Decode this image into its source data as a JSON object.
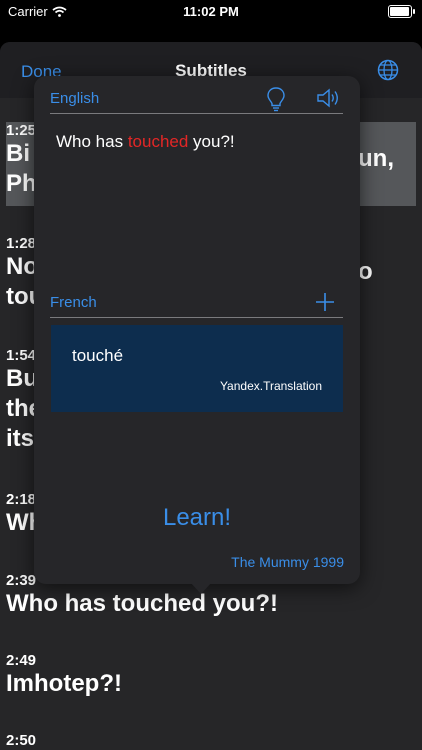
{
  "status": {
    "carrier": "Carrier",
    "time": "11:02 PM"
  },
  "nav": {
    "done": "Done",
    "title": "Subtitles"
  },
  "entries": [
    {
      "time": "1:25",
      "line1": "Bi",
      "line2": "Ph",
      "tail1": "un,",
      "tail2": ""
    },
    {
      "time": "1:28",
      "line1": "No",
      "line2": "tou",
      "tail1": "o",
      "tail2": ""
    },
    {
      "time": "1:54",
      "line1": "Bu",
      "line2": "the",
      "line3": "its"
    },
    {
      "time": "2:18",
      "line1": "Wh"
    },
    {
      "time": "2:39",
      "line1": "Who has touched you?!"
    },
    {
      "time": "2:49",
      "line1": "Imhotep?!"
    },
    {
      "time": "2:50"
    }
  ],
  "popover": {
    "source_lang": "English",
    "target_lang": "French",
    "source_before": "Who has ",
    "source_highlight": "touched",
    "source_after": " you?!",
    "translation": "touché",
    "credit": "Yandex.Translation",
    "learn": "Learn!",
    "movie": "The Mummy 1999"
  },
  "colors": {
    "accent": "#3a8ee8",
    "highlight_word": "#e32626",
    "result_bg": "#0d2d4e"
  },
  "icons": [
    "wifi-icon",
    "battery-icon",
    "globe-icon",
    "lightbulb-icon",
    "speaker-icon",
    "plus-icon"
  ]
}
